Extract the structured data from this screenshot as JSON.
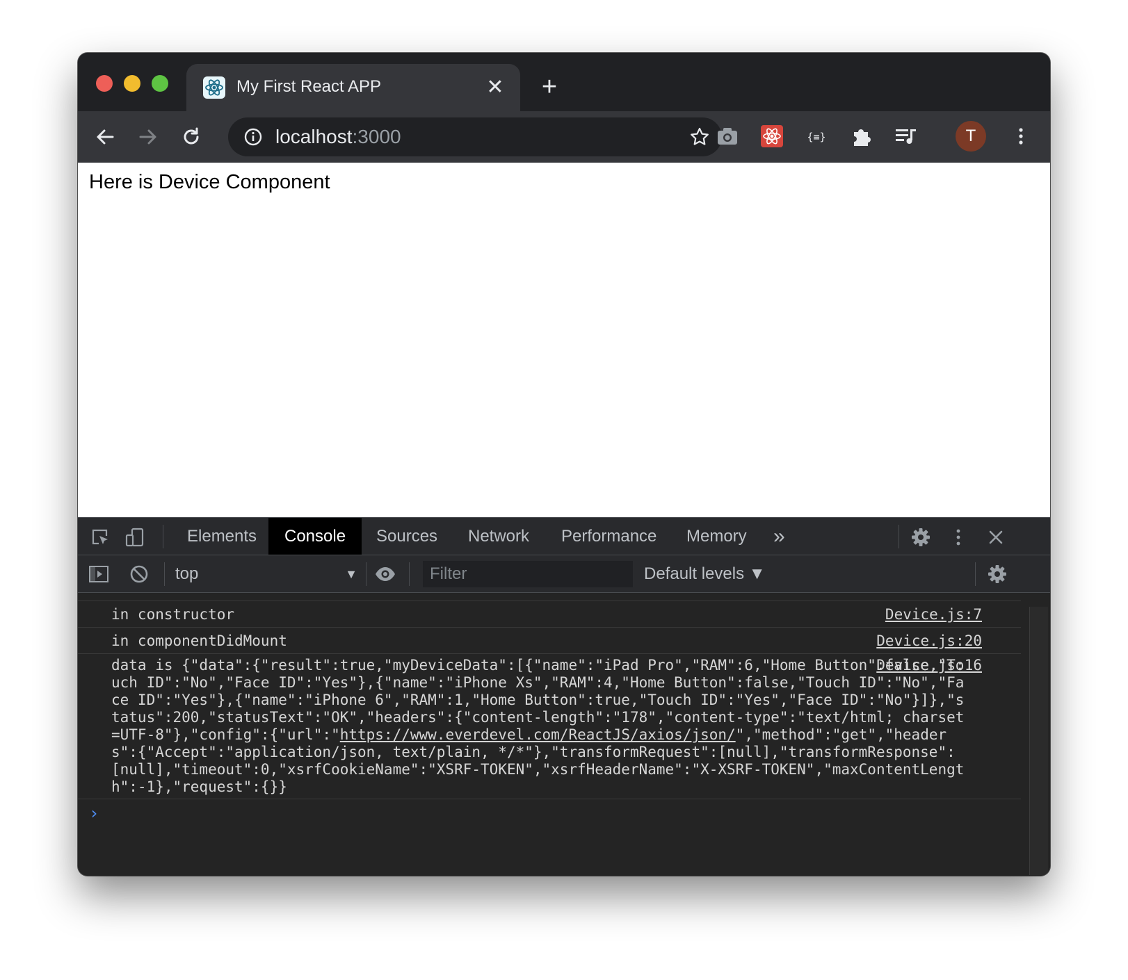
{
  "browser": {
    "tab": {
      "title": "My First React APP"
    },
    "address": {
      "host": "localhost",
      "port": ":3000"
    },
    "avatar_initial": "T"
  },
  "page": {
    "text": "Here is Device Component"
  },
  "devtools": {
    "tabs": [
      "Elements",
      "Console",
      "Sources",
      "Network",
      "Performance",
      "Memory"
    ],
    "active_tab": "Console",
    "more_tabs": "»",
    "context": "top",
    "filter_placeholder": "Filter",
    "levels": "Default levels ▼",
    "console": {
      "messages": [
        {
          "text": "in constructor",
          "source": "Device.js:7"
        },
        {
          "text": "in componentDidMount",
          "source": "Device.js:20"
        },
        {
          "text_before_link": "data is {\"data\":{\"result\":true,\"myDeviceData\":[{\"name\":\"iPad Pro\",\"RAM\":6,\"Home Button\":false,\"Touch ID\":\"No\",\"Face ID\":\"Yes\"},{\"name\":\"iPhone Xs\",\"RAM\":4,\"Home Button\":false,\"Touch ID\":\"No\",\"Face ID\":\"Yes\"},{\"name\":\"iPhone 6\",\"RAM\":1,\"Home Button\":true,\"Touch ID\":\"Yes\",\"Face ID\":\"No\"}]},\"status\":200,\"statusText\":\"OK\",\"headers\":{\"content-length\":\"178\",\"content-type\":\"text/html; charset=UTF-8\"},\"config\":{\"url\":\"",
          "link": "https://www.everdevel.com/ReactJS/axios/json/",
          "text_after_link": "\",\"method\":\"get\",\"headers\":{\"Accept\":\"application/json, text/plain, */*\"},\"transformRequest\":[null],\"transformResponse\":[null],\"timeout\":0,\"xsrfCookieName\":\"XSRF-TOKEN\",\"xsrfHeaderName\":\"X-XSRF-TOKEN\",\"maxContentLength\":-1},\"request\":{}}",
          "source": "Device.js:16"
        }
      ],
      "prompt": "›"
    }
  },
  "colors": {
    "frame": "#202124",
    "toolbar": "#35363a",
    "devtools_bg": "#242424",
    "prompt": "#4f8ff7",
    "react_ext": "#d7463c"
  },
  "icons": [
    "react-favicon-icon",
    "close-icon",
    "plus-icon",
    "back-arrow-icon",
    "forward-arrow-icon",
    "reload-icon",
    "info-icon",
    "star-icon",
    "camera-icon",
    "react-devtools-icon",
    "json-viewer-icon",
    "puzzle-icon",
    "media-queue-icon",
    "kebab-menu-icon",
    "inspect-element-icon",
    "device-toggle-icon",
    "gear-icon",
    "sidebar-toggle-icon",
    "clear-console-icon",
    "eye-icon"
  ]
}
